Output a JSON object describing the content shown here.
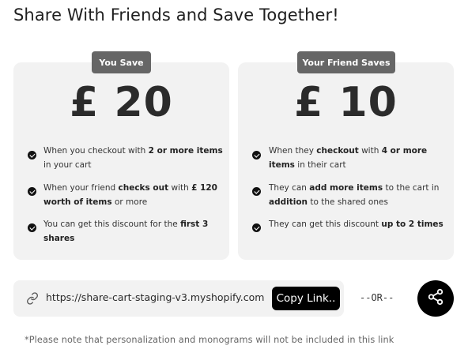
{
  "title": "Share With Friends and Save Together!",
  "you_save": {
    "label": "You Save",
    "amount": "£ 20",
    "benefits": [
      [
        {
          "t": "When you checkout with ",
          "b": false
        },
        {
          "t": "2 or more items",
          "b": true
        },
        {
          "t": " in your cart",
          "b": false
        }
      ],
      [
        {
          "t": "When your friend ",
          "b": false
        },
        {
          "t": "checks out",
          "b": true
        },
        {
          "t": " with ",
          "b": false
        },
        {
          "t": "£ 120 worth of items",
          "b": true
        },
        {
          "t": " or more",
          "b": false
        }
      ],
      [
        {
          "t": "You can get this discount for the ",
          "b": false
        },
        {
          "t": "first 3 shares",
          "b": true
        }
      ]
    ]
  },
  "friend_saves": {
    "label": "Your Friend Saves",
    "amount": "£ 10",
    "benefits": [
      [
        {
          "t": "When they ",
          "b": false
        },
        {
          "t": "checkout",
          "b": true
        },
        {
          "t": " with ",
          "b": false
        },
        {
          "t": "4 or more items",
          "b": true
        },
        {
          "t": " in their cart",
          "b": false
        }
      ],
      [
        {
          "t": "They can ",
          "b": false
        },
        {
          "t": "add more items",
          "b": true
        },
        {
          "t": " to the cart in ",
          "b": false
        },
        {
          "t": "addition",
          "b": true
        },
        {
          "t": " to the shared ones",
          "b": false
        }
      ],
      [
        {
          "t": "They can get this discount ",
          "b": false
        },
        {
          "t": "up to 2 times",
          "b": true
        }
      ]
    ]
  },
  "share": {
    "url": "https://share-cart-staging-v3.myshopify.com",
    "copy_label": "Copy Link..",
    "or_label": "--OR--",
    "link_icon": "link-icon",
    "share_icon": "share-icon"
  },
  "note": "*Please note that personalization and monograms will not be included in this link",
  "colors": {
    "card_bg": "#f2f2f2",
    "pill_bg": "#666666",
    "button_bg": "#000000",
    "text": "#222222"
  }
}
